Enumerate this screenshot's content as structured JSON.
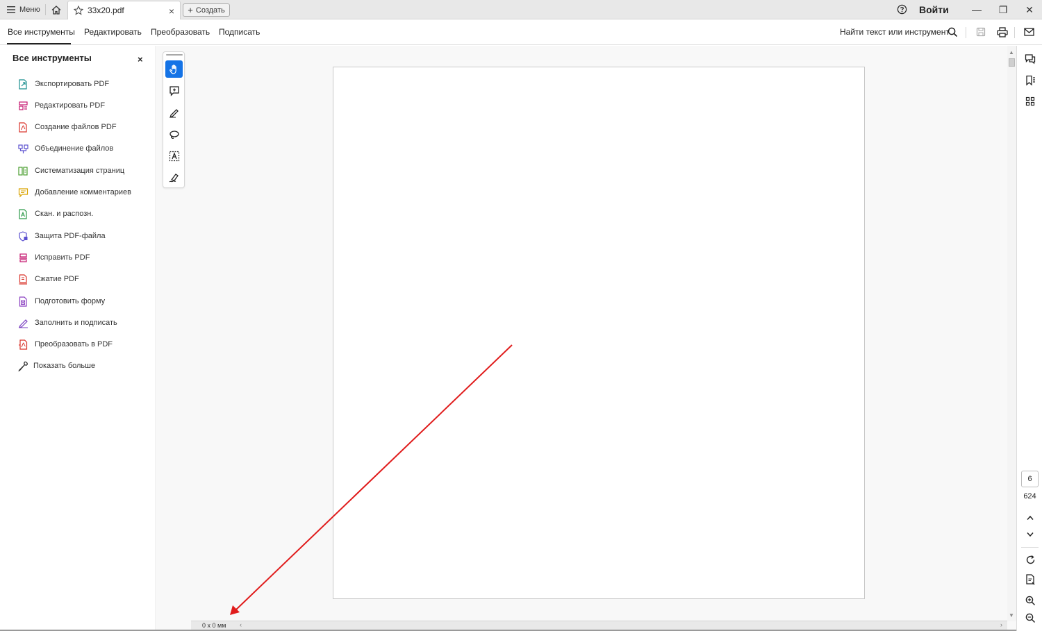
{
  "titlebar": {
    "menu_label": "Меню",
    "tab_title": "33x20.pdf",
    "tab_close": "×",
    "create_label": "Создать",
    "login_label": "Войти",
    "window_minimize": "—",
    "window_restore": "❐",
    "window_close": "✕"
  },
  "toolbar": {
    "tabs": [
      "Все инструменты",
      "Редактировать",
      "Преобразовать",
      "Подписать"
    ],
    "active_tab": "Все инструменты",
    "search_label": "Найти текст или инструмент"
  },
  "left_panel": {
    "title": "Все инструменты",
    "close": "×",
    "items": [
      {
        "label": "Экспортировать PDF",
        "icon": "export-pdf-icon",
        "color": "#1a8f8f"
      },
      {
        "label": "Редактировать PDF",
        "icon": "edit-pdf-icon",
        "color": "#c4166f"
      },
      {
        "label": "Создание файлов PDF",
        "icon": "create-pdf-icon",
        "color": "#d9342b"
      },
      {
        "label": "Объединение файлов",
        "icon": "combine-files-icon",
        "color": "#5a4fcf"
      },
      {
        "label": "Систематизация страниц",
        "icon": "organize-pages-icon",
        "color": "#4a9e2f"
      },
      {
        "label": "Добавление комментариев",
        "icon": "add-comment-icon",
        "color": "#d9a300"
      },
      {
        "label": "Скан. и распозн.",
        "icon": "scan-ocr-icon",
        "color": "#2d9a4a"
      },
      {
        "label": "Защита PDF-файла",
        "icon": "protect-pdf-icon",
        "color": "#5a4fcf"
      },
      {
        "label": "Исправить PDF",
        "icon": "redact-pdf-icon",
        "color": "#c4166f"
      },
      {
        "label": "Сжатие PDF",
        "icon": "compress-pdf-icon",
        "color": "#d9342b"
      },
      {
        "label": "Подготовить форму",
        "icon": "prepare-form-icon",
        "color": "#8a3fc0"
      },
      {
        "label": "Заполнить и подписать",
        "icon": "fill-sign-icon",
        "color": "#7a3fc0"
      },
      {
        "label": "Преобразовать в PDF",
        "icon": "convert-to-pdf-icon",
        "color": "#d9342b"
      },
      {
        "label": "Показать больше",
        "icon": "wrench-icon",
        "color": "#333333"
      }
    ]
  },
  "viewer": {
    "page_current": "6",
    "page_total": "624",
    "dimensions": "0 x 0 мм"
  },
  "colors": {
    "accent": "#1473e6",
    "annotation_arrow": "#e01b1b"
  }
}
